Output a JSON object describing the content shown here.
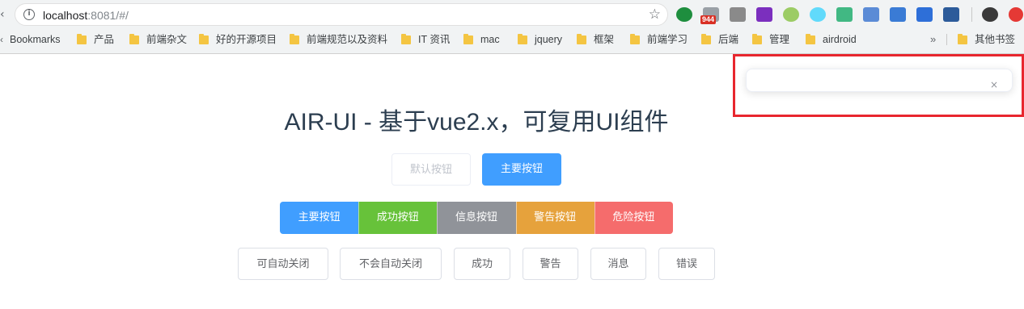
{
  "browser": {
    "url_host": "localhost",
    "url_rest": ":8081/#/",
    "extensions": [
      {
        "name": "extension-green-d",
        "color": "#1e8e3e"
      },
      {
        "name": "extension-mail",
        "color": "#9aa0a6",
        "badge": "944"
      },
      {
        "name": "extension-abp",
        "color": "#8a8a8a"
      },
      {
        "name": "extension-rp",
        "color": "#7b2fbe"
      },
      {
        "name": "extension-green-circle",
        "color": "#9ccc65"
      },
      {
        "name": "extension-react",
        "color": "#61dafb"
      },
      {
        "name": "extension-vue",
        "color": "#41b883"
      },
      {
        "name": "extension-image",
        "color": "#5b8bd6"
      },
      {
        "name": "extension-edge",
        "color": "#3a7bd5"
      },
      {
        "name": "extension-globe",
        "color": "#2e6fd8"
      },
      {
        "name": "extension-square",
        "color": "#2c5b9a"
      }
    ],
    "profile_color": "#3a3a3a",
    "update_color": "#e53935",
    "bookmarks": [
      {
        "label": "Bookmarks",
        "type": "apps"
      },
      {
        "label": "产品",
        "type": "folder"
      },
      {
        "label": "前端杂文",
        "type": "folder"
      },
      {
        "label": "好的开源项目",
        "type": "folder"
      },
      {
        "label": "前端规范以及资料",
        "type": "folder"
      },
      {
        "label": "IT 资讯",
        "type": "folder"
      },
      {
        "label": "mac",
        "type": "folder"
      },
      {
        "label": "jquery",
        "type": "folder"
      },
      {
        "label": "框架",
        "type": "folder"
      },
      {
        "label": "前端学习",
        "type": "folder"
      },
      {
        "label": "后端",
        "type": "folder"
      },
      {
        "label": "管理",
        "type": "folder"
      },
      {
        "label": "airdroid",
        "type": "folder"
      }
    ],
    "more_label": "»",
    "other_bookmarks": "其他书签"
  },
  "page": {
    "title": "AIR-UI - 基于vue2.x，可复用UI组件",
    "row1": {
      "default_label": "默认按钮",
      "primary_label": "主要按钮"
    },
    "button_group": [
      {
        "label": "主要按钮",
        "type": "primary"
      },
      {
        "label": "成功按钮",
        "type": "success"
      },
      {
        "label": "信息按钮",
        "type": "info"
      },
      {
        "label": "警告按钮",
        "type": "warning"
      },
      {
        "label": "危险按钮",
        "type": "danger"
      }
    ],
    "notify_buttons": [
      {
        "label": "可自动关闭"
      },
      {
        "label": "不会自动关闭"
      },
      {
        "label": "成功"
      },
      {
        "label": "警告"
      },
      {
        "label": "消息"
      },
      {
        "label": "错误"
      }
    ]
  },
  "notification": {
    "close_symbol": "×",
    "highlight_color": "#e8262e"
  },
  "colors": {
    "primary": "#409eff",
    "success": "#67c23a",
    "info": "#909399",
    "warning": "#e6a23c",
    "danger": "#f56c6c"
  }
}
